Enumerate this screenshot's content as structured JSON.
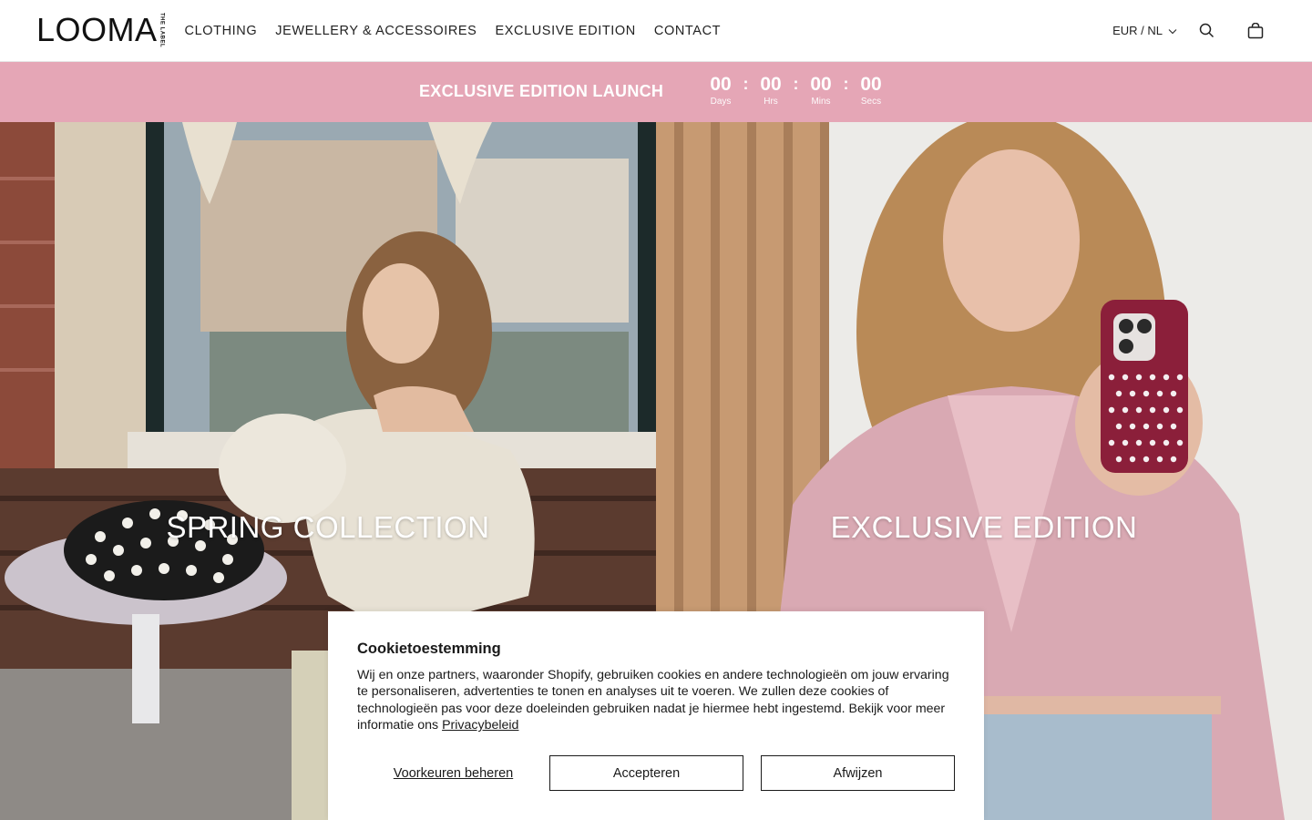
{
  "header": {
    "logo": "LOOMA",
    "logo_sub": "THE LABEL",
    "nav": [
      "CLOTHING",
      "JEWELLERY & ACCESSOIRES",
      "EXCLUSIVE EDITION",
      "CONTACT"
    ],
    "currency": "EUR / NL",
    "icons": [
      "chevron-down-icon",
      "search-icon",
      "cart-icon"
    ]
  },
  "countdown": {
    "title": "EXCLUSIVE EDITION LAUNCH",
    "units": [
      {
        "value": "00",
        "label": "Days"
      },
      {
        "value": "00",
        "label": "Hrs"
      },
      {
        "value": "00",
        "label": "Mins"
      },
      {
        "value": "00",
        "label": "Secs"
      }
    ],
    "separator": ":",
    "color": "#e5a6b6"
  },
  "hero": {
    "left_title": "SPRING COLLECTION",
    "right_title": "EXCLUSIVE EDITION"
  },
  "cookie": {
    "title": "Cookietoestemming",
    "text": "Wij en onze partners, waaronder Shopify, gebruiken cookies en andere technologieën om jouw ervaring te personaliseren, advertenties te tonen en analyses uit te voeren. We zullen deze cookies of technologieën pas voor deze doeleinden gebruiken nadat je hiermee hebt ingestemd. Bekijk voor meer informatie ons ",
    "privacy_link": "Privacybeleid",
    "manage_label": "Voorkeuren beheren",
    "accept_label": "Accepteren",
    "decline_label": "Afwijzen"
  }
}
